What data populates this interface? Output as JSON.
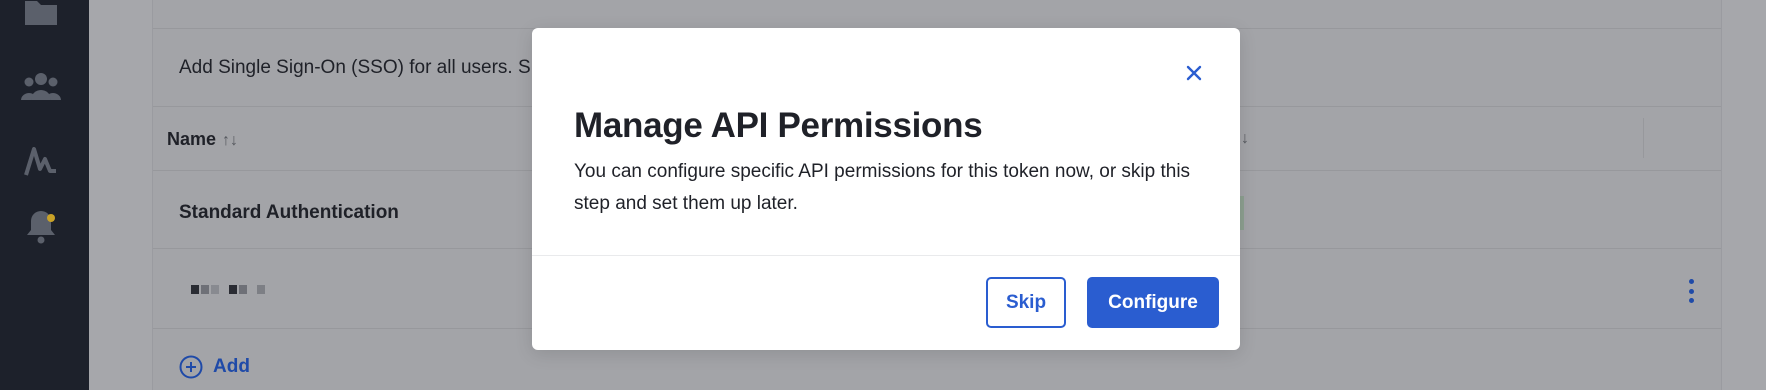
{
  "sidebar": {
    "icons": [
      "folder-icon",
      "users-icon",
      "activity-icon",
      "bell-icon"
    ],
    "notification_color": "#c9a227"
  },
  "page": {
    "description": "Add Single Sign-On (SSO) for all users. S",
    "table": {
      "column_name_header": "Name",
      "sort_asc": "↑",
      "sort_desc": "↓",
      "right_sort": "↓",
      "rows": [
        {
          "name": "Standard Authentication"
        }
      ]
    },
    "add_label": "Add"
  },
  "modal": {
    "title": "Manage API Permissions",
    "body": "You can configure specific API permissions for this token now, or skip this step and set them up later.",
    "close_icon": "close-icon",
    "skip_label": "Skip",
    "configure_label": "Configure",
    "accent_color": "#2a5dd0"
  }
}
